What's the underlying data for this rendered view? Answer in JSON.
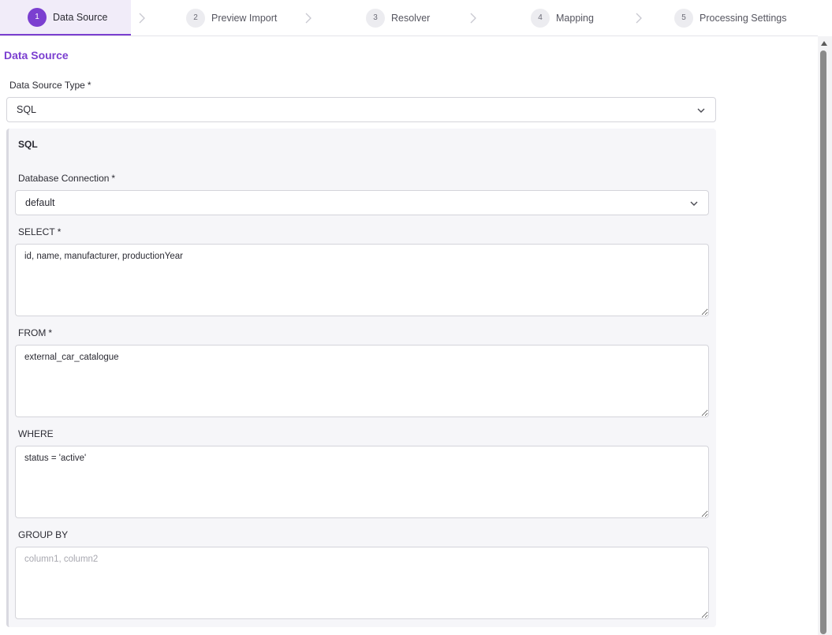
{
  "stepper": {
    "steps": [
      {
        "number": "1",
        "label": "Data Source",
        "active": true
      },
      {
        "number": "2",
        "label": "Preview Import",
        "active": false
      },
      {
        "number": "3",
        "label": "Resolver",
        "active": false
      },
      {
        "number": "4",
        "label": "Mapping",
        "active": false
      },
      {
        "number": "5",
        "label": "Processing Settings",
        "active": false
      }
    ],
    "separator_icon": "chevron-right-icon"
  },
  "section": {
    "title": "Data Source"
  },
  "data_source_type": {
    "label": "Data Source Type",
    "required_marker": "*",
    "value": "SQL",
    "icon": "chevron-down-icon"
  },
  "sql_panel": {
    "title": "SQL",
    "database_connection": {
      "label": "Database Connection",
      "required_marker": "*",
      "value": "default",
      "icon": "chevron-down-icon"
    },
    "select": {
      "label": "SELECT",
      "required_marker": "*",
      "value": "id, name, manufacturer, productionYear",
      "placeholder": ""
    },
    "from": {
      "label": "FROM",
      "required_marker": "*",
      "value": "external_car_catalogue",
      "placeholder": ""
    },
    "where": {
      "label": "WHERE",
      "value": "status = 'active'",
      "placeholder": ""
    },
    "group_by": {
      "label": "GROUP BY",
      "value": "",
      "placeholder": "column1, column2"
    }
  },
  "colors": {
    "accent": "#7b3fd0",
    "active_step_bg": "#f1ecf9",
    "panel_bg": "#f6f6f9",
    "border": "#d4d4da"
  }
}
